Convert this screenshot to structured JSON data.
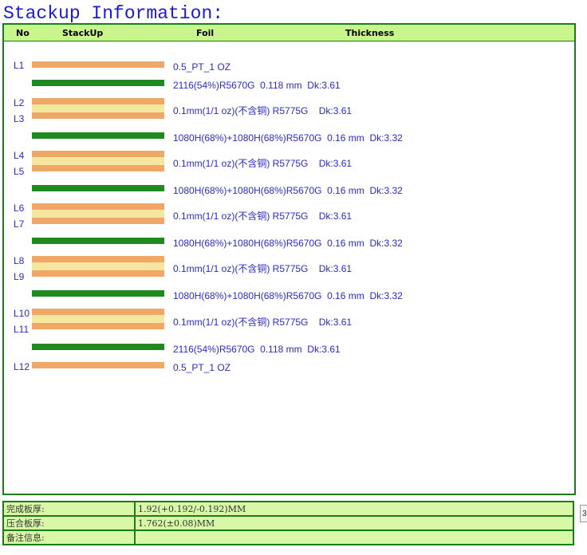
{
  "page_title": "Stackup Information:",
  "columns": {
    "no": "No",
    "stackup": "StackUp",
    "foil": "Foil",
    "thickness": "Thickness"
  },
  "layers": [
    "L1",
    "L2",
    "L3",
    "L4",
    "L5",
    "L6",
    "L7",
    "L8",
    "L9",
    "L10",
    "L11",
    "L12"
  ],
  "stackup_info": [
    "0.5_PT_1 OZ",
    "2116(54%)R5670G  0.118 mm  Dk:3.61",
    "0.1mm(1/1 oz)(不含铜) R5775G    Dk:3.61",
    "1080H(68%)+1080H(68%)R5670G  0.16 mm  Dk:3.32",
    "0.1mm(1/1 oz)(不含铜) R5775G    Dk:3.61",
    "1080H(68%)+1080H(68%)R5670G  0.16 mm  Dk:3.32",
    "0.1mm(1/1 oz)(不含铜) R5775G    Dk:3.61",
    "1080H(68%)+1080H(68%)R5670G  0.16 mm  Dk:3.32",
    "0.1mm(1/1 oz)(不含铜) R5775G    Dk:3.61",
    "1080H(68%)+1080H(68%)R5670G  0.16 mm  Dk:3.32",
    "0.1mm(1/1 oz)(不含铜) R5775G    Dk:3.61",
    "2116(54%)R5670G  0.118 mm  Dk:3.61",
    "0.5_PT_1 OZ"
  ],
  "summary": [
    {
      "label": "完成板厚:",
      "value": "1.92(+0.192/-0.192)MM"
    },
    {
      "label": "压合板厚:",
      "value": "1.762(±0.08)MM"
    },
    {
      "label": "备注信息:",
      "value": ""
    }
  ],
  "side_tab": "3",
  "colors": {
    "copper": "#f0a868",
    "prepreg": "#1f8a1f",
    "core": "#f5e6a0",
    "header": "#c8f58c",
    "border": "#1a7d1a",
    "title": "#1a1ad2"
  }
}
